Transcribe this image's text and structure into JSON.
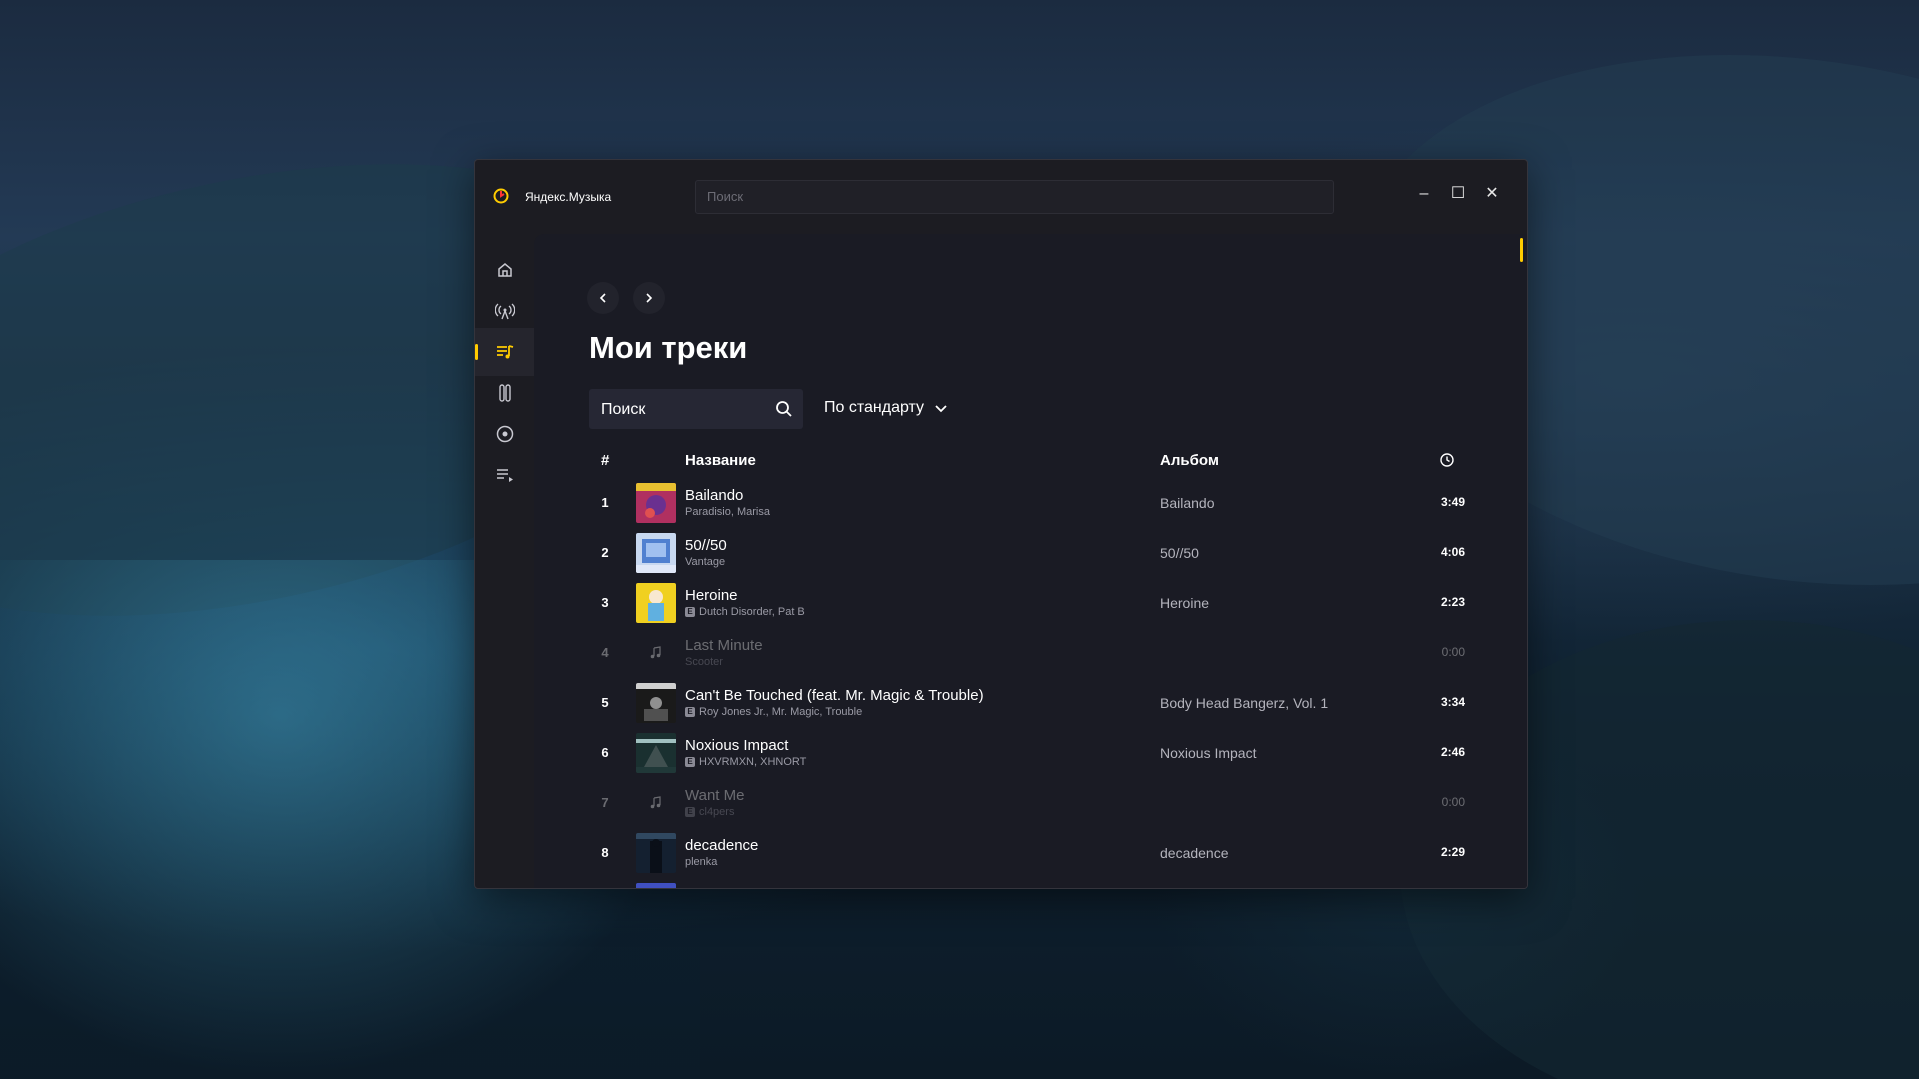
{
  "app": {
    "title": "Яндекс.Музыка"
  },
  "top_search": {
    "placeholder": "Поиск"
  },
  "window_controls": {
    "minimize": "–",
    "maximize": "☐",
    "close": "✕"
  },
  "sidebar": {
    "items": [
      {
        "icon": "home-icon",
        "active": false
      },
      {
        "icon": "radio-icon",
        "active": false
      },
      {
        "icon": "my-tracks-icon",
        "active": true
      },
      {
        "icon": "podcast-icon",
        "active": false
      },
      {
        "icon": "album-icon",
        "active": false
      },
      {
        "icon": "playlist-icon",
        "active": false
      }
    ]
  },
  "page": {
    "title": "Мои треки",
    "search_placeholder": "Поиск",
    "sort_label": "По стандарту"
  },
  "table": {
    "headers": {
      "num": "#",
      "title": "Название",
      "album": "Альбом",
      "duration": "clock-icon"
    },
    "rows": [
      {
        "num": "1",
        "title": "Bailando",
        "artist": "Paradisio, Marisa",
        "explicit": false,
        "album": "Bailando",
        "duration": "3:49",
        "available": true
      },
      {
        "num": "2",
        "title": "50//50",
        "artist": "Vantage",
        "explicit": false,
        "album": "50//50",
        "duration": "4:06",
        "available": true
      },
      {
        "num": "3",
        "title": "Heroine",
        "artist": "Dutch Disorder, Pat B",
        "explicit": true,
        "album": "Heroine",
        "duration": "2:23",
        "available": true
      },
      {
        "num": "4",
        "title": "Last Minute",
        "artist": "Scooter",
        "explicit": false,
        "album": "",
        "duration": "0:00",
        "available": false
      },
      {
        "num": "5",
        "title": "Can't Be Touched (feat. Mr. Magic & Trouble)",
        "artist": "Roy Jones Jr., Mr. Magic, Trouble",
        "explicit": true,
        "album": "Body Head Bangerz, Vol. 1",
        "duration": "3:34",
        "available": true
      },
      {
        "num": "6",
        "title": "Noxious Impact",
        "artist": "HXVRMXN, XHNORT",
        "explicit": true,
        "album": "Noxious Impact",
        "duration": "2:46",
        "available": true
      },
      {
        "num": "7",
        "title": "Want Me",
        "artist": "cl4pers",
        "explicit": true,
        "album": "",
        "duration": "0:00",
        "available": false
      },
      {
        "num": "8",
        "title": "decadence",
        "artist": "plenka",
        "explicit": false,
        "album": "decadence",
        "duration": "2:29",
        "available": true
      }
    ]
  },
  "colors": {
    "accent": "#ffcc00",
    "window_bg": "#1c1c22",
    "content_bg": "#1a1b24"
  }
}
